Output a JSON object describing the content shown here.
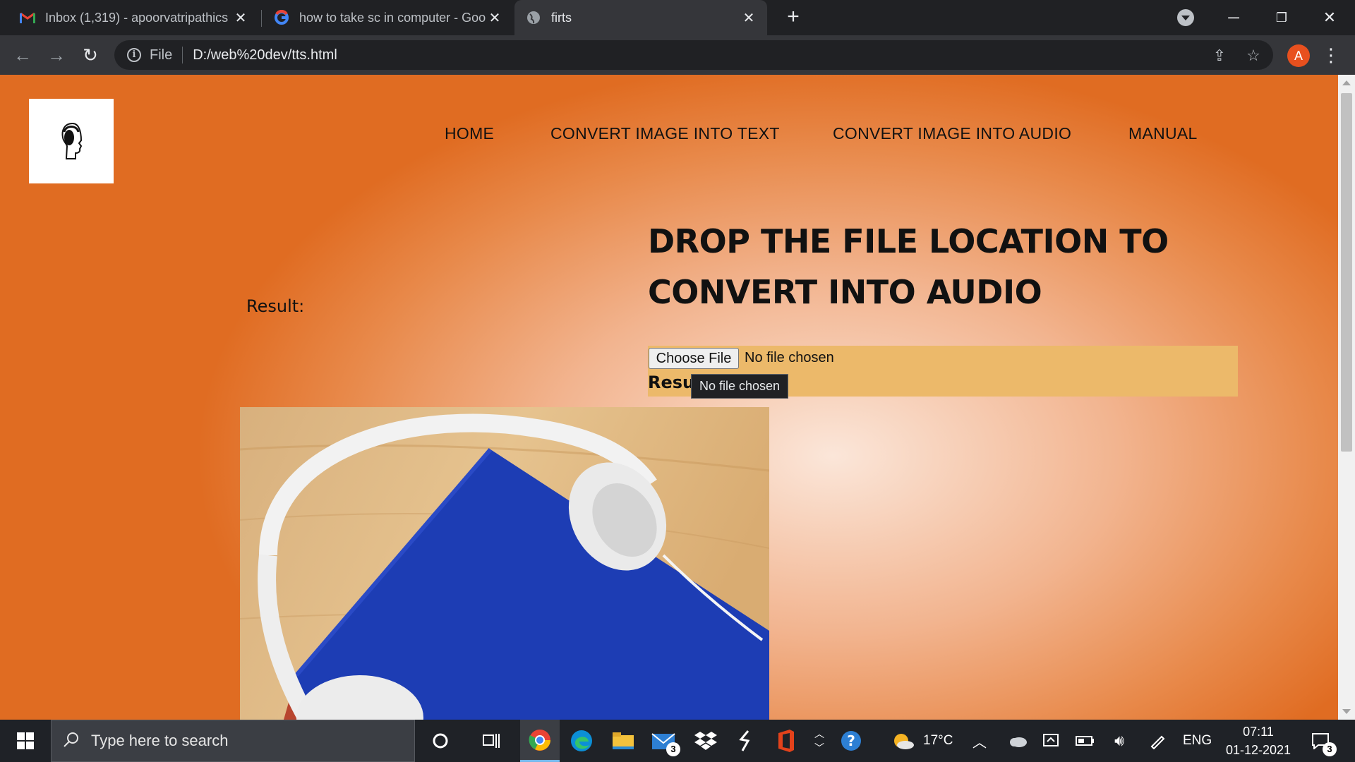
{
  "browser": {
    "tabs": [
      {
        "title": "Inbox (1,319) - apoorvatripathics",
        "icon": "gmail-icon",
        "active": false
      },
      {
        "title": "how to take sc in computer - Goo",
        "icon": "google-icon",
        "active": false
      },
      {
        "title": "firts",
        "icon": "globe-icon",
        "active": true
      }
    ],
    "address": {
      "scheme": "File",
      "url": "D:/web%20dev/tts.html"
    },
    "profile_initial": "A",
    "accent_color": "#e8501e"
  },
  "page": {
    "nav": [
      "HOME",
      "CONVERT IMAGE INTO TEXT",
      "CONVERT IMAGE INTO AUDIO",
      "MANUAL"
    ],
    "heading_line1": "DROP THE FILE LOCATION TO",
    "heading_line2": "CONVERT INTO AUDIO",
    "result_label": "Result:",
    "file_input": {
      "button": "Choose File",
      "status": "No file chosen"
    },
    "result_under": "Resu",
    "tooltip": "No file chosen",
    "colors": {
      "upload_box": "#ecb96a",
      "gradient_edge": "#e06c22",
      "gradient_center": "#fbe6d9"
    }
  },
  "taskbar": {
    "search_placeholder": "Type here to search",
    "mail_badge": "3",
    "weather": "17°C",
    "language": "ENG",
    "time": "07:11",
    "date": "01-12-2021",
    "notification_count": "3"
  }
}
